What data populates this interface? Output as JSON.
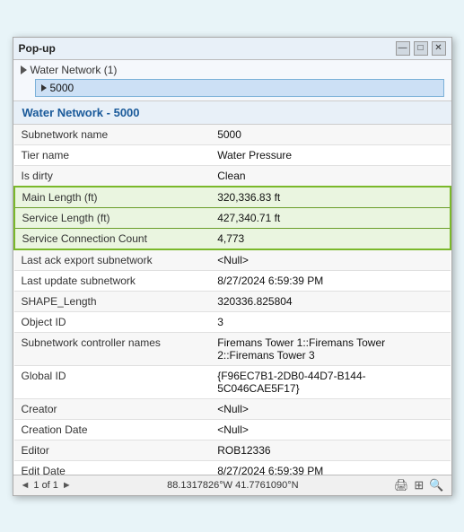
{
  "window": {
    "title": "Pop-up",
    "controls": {
      "minimize": "—",
      "restore": "□",
      "close": "✕"
    }
  },
  "tree": {
    "group_label": "Water Network (1)",
    "selected_item": "5000"
  },
  "section_title": "Water Network - 5000",
  "fields": [
    {
      "label": "Subnetwork name",
      "value": "5000",
      "highlight": false
    },
    {
      "label": "Tier name",
      "value": "Water Pressure",
      "highlight": false
    },
    {
      "label": "Is dirty",
      "value": "Clean",
      "highlight": false
    },
    {
      "label": "Main Length (ft)",
      "value": "320,336.83 ft",
      "highlight": true
    },
    {
      "label": "Service Length (ft)",
      "value": "427,340.71 ft",
      "highlight": true
    },
    {
      "label": "Service Connection Count",
      "value": "4,773",
      "highlight": true
    },
    {
      "label": "Last ack export subnetwork",
      "value": "<Null>",
      "highlight": false
    },
    {
      "label": "Last update subnetwork",
      "value": "8/27/2024 6:59:39 PM",
      "highlight": false
    },
    {
      "label": "SHAPE_Length",
      "value": "320336.825804",
      "highlight": false
    },
    {
      "label": "Object ID",
      "value": "3",
      "highlight": false
    },
    {
      "label": "Subnetwork controller names",
      "value": "Firemans Tower 1::Firemans Tower 2::Firemans Tower 3",
      "highlight": false
    },
    {
      "label": "Global ID",
      "value": "{F96EC7B1-2DB0-44D7-B144-5C046CAE5F17}",
      "highlight": false
    },
    {
      "label": "Creator",
      "value": "<Null>",
      "highlight": false
    },
    {
      "label": "Creation Date",
      "value": "<Null>",
      "highlight": false
    },
    {
      "label": "Editor",
      "value": "ROB12336",
      "highlight": false
    },
    {
      "label": "Edit Date",
      "value": "8/27/2024 6:59:39 PM",
      "highlight": false
    }
  ],
  "footer": {
    "pagination": "1 of 1",
    "coords": "88.1317826°W 41.7761090°N",
    "prev_label": "◄",
    "next_label": "►"
  }
}
